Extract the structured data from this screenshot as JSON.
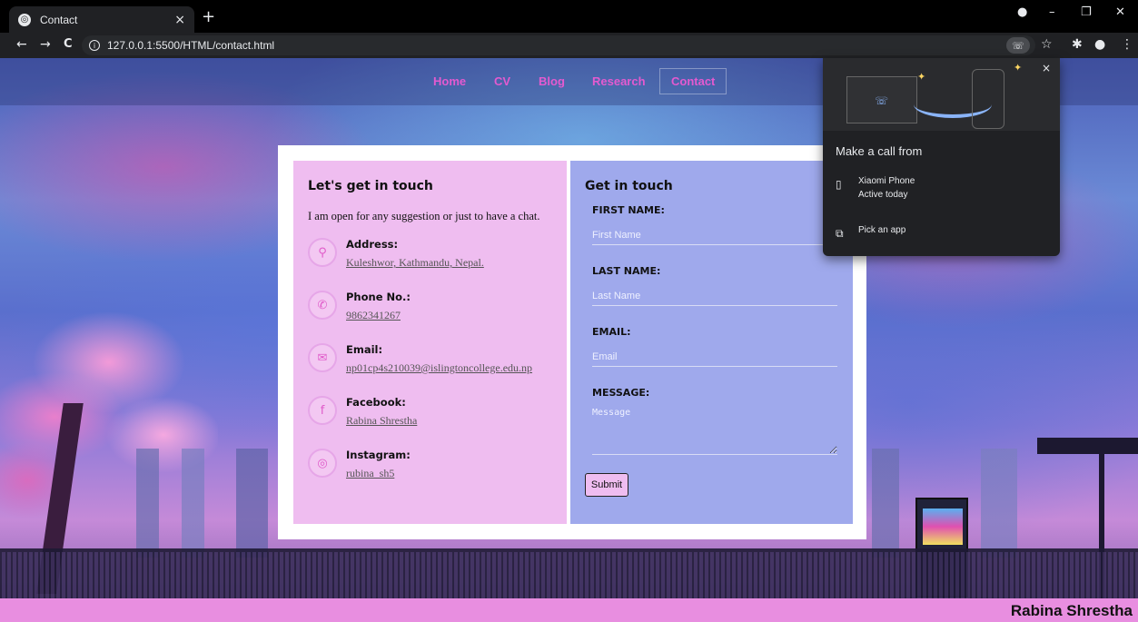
{
  "browser": {
    "tab_title": "Contact",
    "tab_close": "×",
    "new_tab": "+",
    "url": "127.0.0.1:5500/HTML/contact.html",
    "icons": {
      "back": "←",
      "forward": "→",
      "reload": "C",
      "info": "i",
      "call": "☏",
      "bookmark": "☆",
      "extensions": "✱",
      "menu": "⋮",
      "minimize": "–",
      "restore": "❐",
      "close": "✕",
      "profile": "●"
    }
  },
  "nav": {
    "items": [
      "Home",
      "CV",
      "Blog",
      "Research",
      "Contact"
    ],
    "active": "Contact",
    "link_color": "#e45ad0"
  },
  "contact_info": {
    "title": "Let's get in touch",
    "intro": "I am open for any suggestion or just to have a chat.",
    "items": [
      {
        "label": "Address:",
        "value": "Kuleshwor, Kathmandu, Nepal.",
        "icon": "location-icon",
        "glyph": "⚲"
      },
      {
        "label": "Phone No.:",
        "value": "9862341267",
        "icon": "phone-icon",
        "glyph": "✆"
      },
      {
        "label": "Email:",
        "value": "np01cp4s210039@islingtoncollege.edu.np",
        "icon": "mail-icon",
        "glyph": "✉"
      },
      {
        "label": "Facebook:",
        "value": "Rabina Shrestha",
        "icon": "facebook-icon",
        "glyph": "f"
      },
      {
        "label": "Instagram:",
        "value": "rubina_sh5",
        "icon": "instagram-icon",
        "glyph": "◎"
      }
    ]
  },
  "form": {
    "title": "Get in touch",
    "first_name_label": "FIRST NAME:",
    "first_name_placeholder": "First Name",
    "last_name_label": "LAST NAME:",
    "last_name_placeholder": "Last Name",
    "email_label": "EMAIL:",
    "email_placeholder": "Email",
    "message_label": "MESSAGE:",
    "message_placeholder": "Message",
    "submit_label": "Submit"
  },
  "call_popup": {
    "title": "Make a call from",
    "device_name": "Xiaomi Phone",
    "device_status": "Active today",
    "pick_app": "Pick an app",
    "close": "×",
    "device_glyph": "▯",
    "pick_glyph": "⧉"
  },
  "footer": {
    "name": "Rabina Shrestha"
  },
  "colors": {
    "left_panel": "#efbdf0",
    "right_panel": "#9fa9ec",
    "footer": "#e88ee0"
  }
}
